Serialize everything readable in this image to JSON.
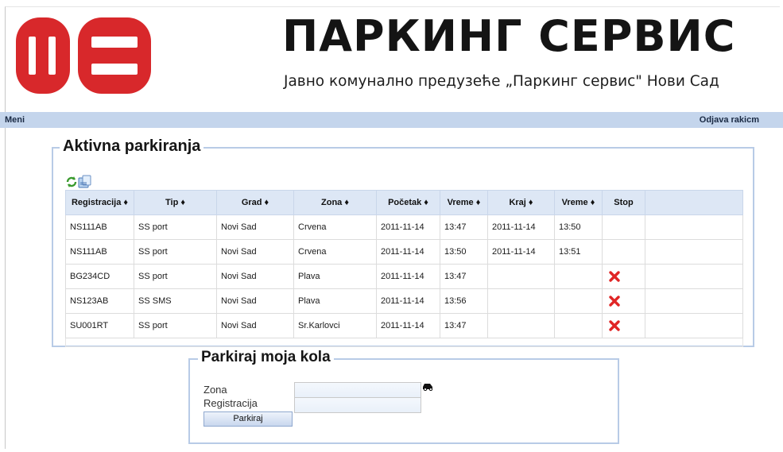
{
  "header": {
    "title": "ПАРКИНГ СЕРВИС",
    "subtitle": "Јавно комунално предузеће „Паркинг сервис\" Нови Сад",
    "brand_color": "#d8282b"
  },
  "menubar": {
    "left_label": "Meni",
    "logout_label": "Odjava rakicm"
  },
  "active_parking": {
    "legend": "Aktivna parkiranja",
    "columns": [
      "Registracija ♦",
      "Tip ♦",
      "Grad ♦",
      "Zona ♦",
      "Početak ♦",
      "Vreme ♦",
      "Kraj ♦",
      "Vreme ♦",
      "Stop"
    ],
    "rows": [
      [
        "NS111AB",
        "SS port",
        "Novi Sad",
        "Crvena",
        "2011-11-14",
        "13:47",
        "2011-11-14",
        "13:50",
        ""
      ],
      [
        "NS111AB",
        "SS port",
        "Novi Sad",
        "Crvena",
        "2011-11-14",
        "13:50",
        "2011-11-14",
        "13:51",
        ""
      ],
      [
        "BG234CD",
        "SS port",
        "Novi Sad",
        "Plava",
        "2011-11-14",
        "13:47",
        "",
        "",
        "stop"
      ],
      [
        "NS123AB",
        "SS SMS",
        "Novi Sad",
        "Plava",
        "2011-11-14",
        "13:56",
        "",
        "",
        "stop"
      ],
      [
        "SU001RT",
        "SS port",
        "Novi Sad",
        "Sr.Karlovci",
        "2011-11-14",
        "13:47",
        "",
        "",
        "stop"
      ]
    ]
  },
  "park_form": {
    "legend": "Parkiraj moja kola",
    "zona_label": "Zona",
    "zona_value": "",
    "registracija_label": "Registracija",
    "registracija_value": "",
    "submit_label": "Parkiraj"
  }
}
